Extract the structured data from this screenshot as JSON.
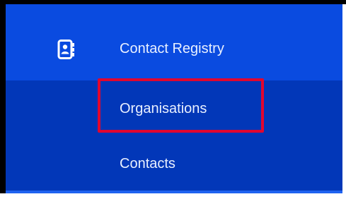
{
  "sidebar": {
    "section": {
      "label": "Contact Registry",
      "icon": "contact-book-icon"
    },
    "items": [
      {
        "label": "Organisations"
      },
      {
        "label": "Contacts"
      }
    ]
  },
  "annotation": {
    "highlighted_item": "Organisations",
    "highlight_color": "#e1062f"
  },
  "colors": {
    "parent_background": "#0a4be0",
    "children_background": "#0237b8",
    "text": "#e9f0ff"
  }
}
